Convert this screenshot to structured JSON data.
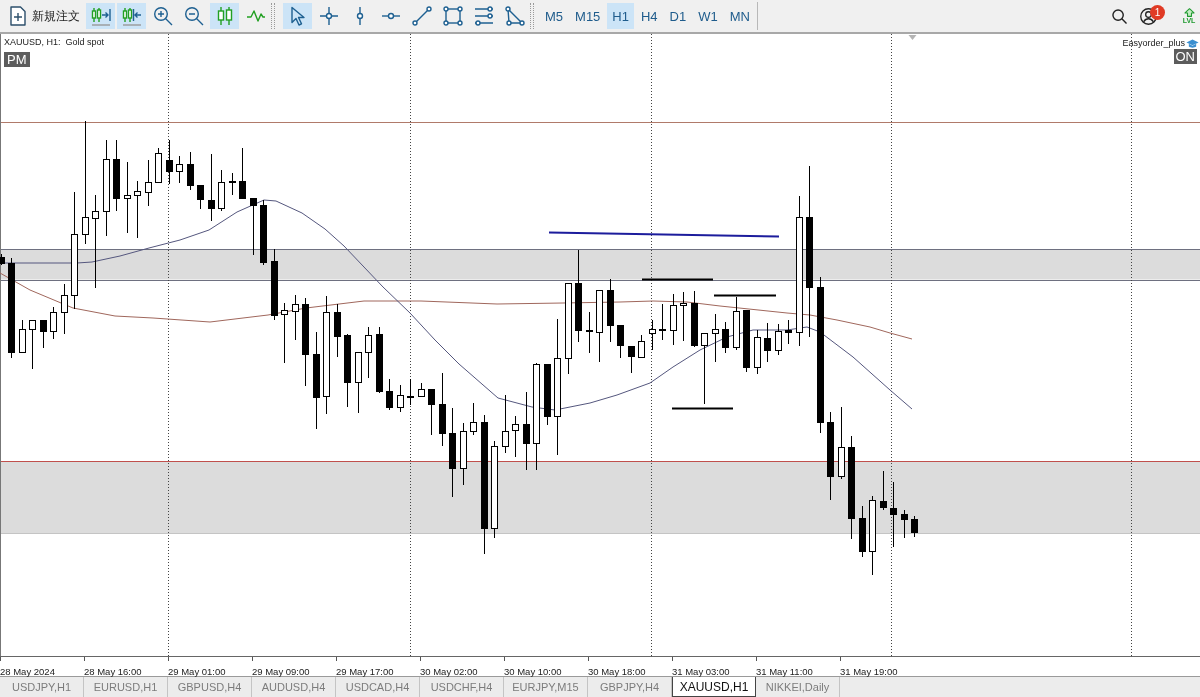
{
  "toolbar": {
    "new_order": {
      "label": "新規注文"
    },
    "chart_tools": [
      {
        "kind": "autoscroll",
        "selected": true
      },
      {
        "kind": "shift",
        "selected": true
      },
      {
        "kind": "zoomin",
        "selected": false
      },
      {
        "kind": "zoomout",
        "selected": false
      },
      {
        "kind": "candles",
        "selected": true
      },
      {
        "kind": "line",
        "selected": false
      }
    ],
    "drawing_tools": [
      {
        "kind": "cursor",
        "selected": true
      },
      {
        "kind": "crosshair",
        "selected": false
      },
      {
        "kind": "vline",
        "selected": false
      },
      {
        "kind": "hline",
        "selected": false
      },
      {
        "kind": "trendline",
        "selected": false
      },
      {
        "kind": "rectangle",
        "selected": false
      },
      {
        "kind": "channels",
        "selected": false
      },
      {
        "kind": "triangle",
        "selected": false
      }
    ],
    "timeframes": [
      {
        "label": "M5",
        "selected": false
      },
      {
        "label": "M15",
        "selected": false
      },
      {
        "label": "H1",
        "selected": true
      },
      {
        "label": "H4",
        "selected": false
      },
      {
        "label": "D1",
        "selected": false
      },
      {
        "label": "W1",
        "selected": false
      },
      {
        "label": "MN",
        "selected": false
      }
    ],
    "notifications": {
      "badge": "1"
    },
    "level_label": "LVL"
  },
  "chart": {
    "title": "XAUUSD, H1:  Gold spot",
    "session_badge": "PM",
    "expert_name": "Easyorder_plus",
    "expert_status": "ON",
    "time_labels": [
      "28 May 2024",
      "28 May 16:00",
      "29 May 01:00",
      "29 May 09:00",
      "29 May 17:00",
      "30 May 02:00",
      "30 May 10:00",
      "30 May 18:00",
      "31 May 03:00",
      "31 May 11:00",
      "31 May 19:00"
    ]
  },
  "tabs": [
    {
      "label": "USDJPY,H1",
      "selected": false
    },
    {
      "label": "EURUSD,H1",
      "selected": false
    },
    {
      "label": "GBPUSD,H4",
      "selected": false
    },
    {
      "label": "AUDUSD,H4",
      "selected": false
    },
    {
      "label": "USDCAD,H4",
      "selected": false
    },
    {
      "label": "USDCHF,H4",
      "selected": false
    },
    {
      "label": "EURJPY,M15",
      "selected": false
    },
    {
      "label": "GBPJPY,H4",
      "selected": false
    },
    {
      "label": "XAUUSD,H1",
      "selected": true
    },
    {
      "label": "NIKKEI,Daily",
      "selected": false
    }
  ]
}
